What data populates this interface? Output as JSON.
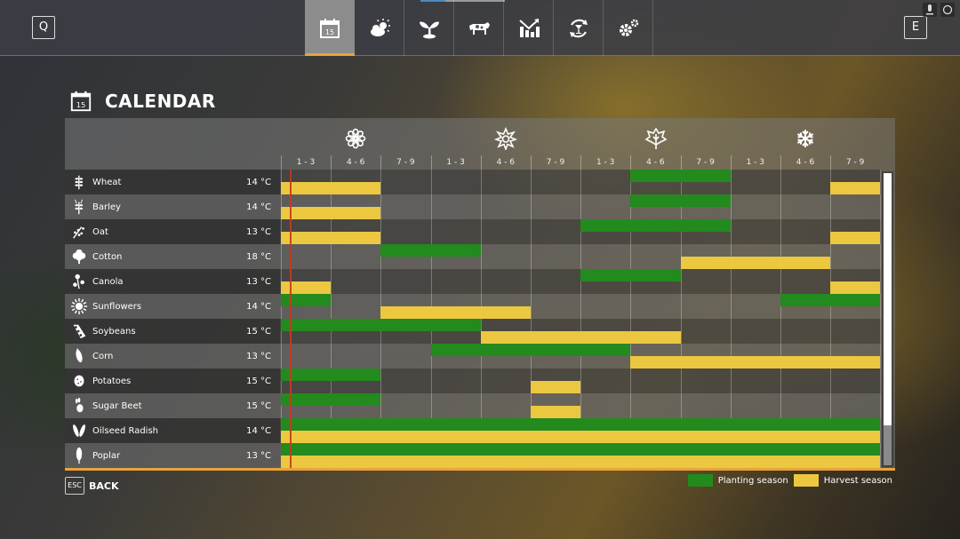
{
  "topbar": {
    "left_key": "Q",
    "right_key": "E",
    "tabs": [
      {
        "icon": "calendar-icon",
        "label": "15",
        "active": true
      },
      {
        "icon": "weather-icon",
        "active": false
      },
      {
        "icon": "sprout-icon",
        "active": false
      },
      {
        "icon": "cow-icon",
        "active": false
      },
      {
        "icon": "statistics-icon",
        "active": false
      },
      {
        "icon": "cycle-icon",
        "active": false
      },
      {
        "icon": "settings-icon",
        "active": false
      }
    ],
    "system_icons": [
      "microphone-icon",
      "sync-icon"
    ]
  },
  "page": {
    "title": "CALENDAR",
    "title_icon_day": "15"
  },
  "calendar": {
    "seasons": [
      {
        "name": "spring",
        "icon": "flower-icon"
      },
      {
        "name": "summer",
        "icon": "sun-icon"
      },
      {
        "name": "autumn",
        "icon": "leaf-icon"
      },
      {
        "name": "winter",
        "icon": "snowflake-icon"
      }
    ],
    "periods": [
      "1 - 3",
      "4 - 6",
      "7 - 9",
      "1 - 3",
      "4 - 6",
      "7 - 9",
      "1 - 3",
      "4 - 6",
      "7 - 9",
      "1 - 3",
      "4 - 6",
      "7 - 9"
    ],
    "current_period_fraction": 0.2,
    "crops": [
      {
        "name": "Wheat",
        "temp": "14 °C",
        "icon": "wheat-icon",
        "planting": [
          7,
          8
        ],
        "harvest": [
          0,
          1,
          11
        ]
      },
      {
        "name": "Barley",
        "temp": "14 °C",
        "icon": "barley-icon",
        "planting": [
          7,
          8
        ],
        "harvest": [
          0,
          1
        ]
      },
      {
        "name": "Oat",
        "temp": "13 °C",
        "icon": "oat-icon",
        "planting": [
          6,
          7,
          8
        ],
        "harvest": [
          0,
          1,
          11
        ]
      },
      {
        "name": "Cotton",
        "temp": "18 °C",
        "icon": "cotton-icon",
        "planting": [
          2,
          3
        ],
        "harvest": [
          8,
          9,
          10
        ]
      },
      {
        "name": "Canola",
        "temp": "13 °C",
        "icon": "canola-icon",
        "planting": [
          6,
          7
        ],
        "harvest": [
          0,
          11
        ]
      },
      {
        "name": "Sunflowers",
        "temp": "14 °C",
        "icon": "sunflower-icon",
        "planting": [
          0,
          10,
          11
        ],
        "harvest": [
          2,
          3,
          4
        ]
      },
      {
        "name": "Soybeans",
        "temp": "15 °C",
        "icon": "soybean-icon",
        "planting": [
          0,
          1,
          2,
          3
        ],
        "harvest": [
          4,
          5,
          6,
          7
        ]
      },
      {
        "name": "Corn",
        "temp": "13 °C",
        "icon": "corn-icon",
        "planting": [
          3,
          4,
          5,
          6
        ],
        "harvest": [
          7,
          8,
          9,
          10,
          11
        ]
      },
      {
        "name": "Potatoes",
        "temp": "15 °C",
        "icon": "potato-icon",
        "planting": [
          0,
          1
        ],
        "harvest": [
          5
        ]
      },
      {
        "name": "Sugar Beet",
        "temp": "15 °C",
        "icon": "sugar-beet-icon",
        "planting": [
          0,
          1
        ],
        "harvest": [
          5
        ]
      },
      {
        "name": "Oilseed Radish",
        "temp": "14 °C",
        "icon": "radish-icon",
        "planting": [
          0,
          1,
          2,
          3,
          4,
          5,
          6,
          7,
          8,
          9,
          10,
          11
        ],
        "harvest": [
          0,
          1,
          2,
          3,
          4,
          5,
          6,
          7,
          8,
          9,
          10,
          11
        ]
      },
      {
        "name": "Poplar",
        "temp": "13 °C",
        "icon": "poplar-icon",
        "planting": [
          0,
          1,
          2,
          3,
          4,
          5,
          6,
          7,
          8,
          9,
          10,
          11
        ],
        "harvest": [
          0,
          1,
          2,
          3,
          4,
          5,
          6,
          7,
          8,
          9,
          10,
          11
        ]
      }
    ]
  },
  "footer": {
    "back_key": "ESC",
    "back_label": "BACK"
  },
  "legend": {
    "planting_label": "Planting season",
    "harvest_label": "Harvest season",
    "planting_color": "#238a1d",
    "harvest_color": "#ecc840"
  },
  "scroll": {
    "visible_fraction": 0.86
  }
}
